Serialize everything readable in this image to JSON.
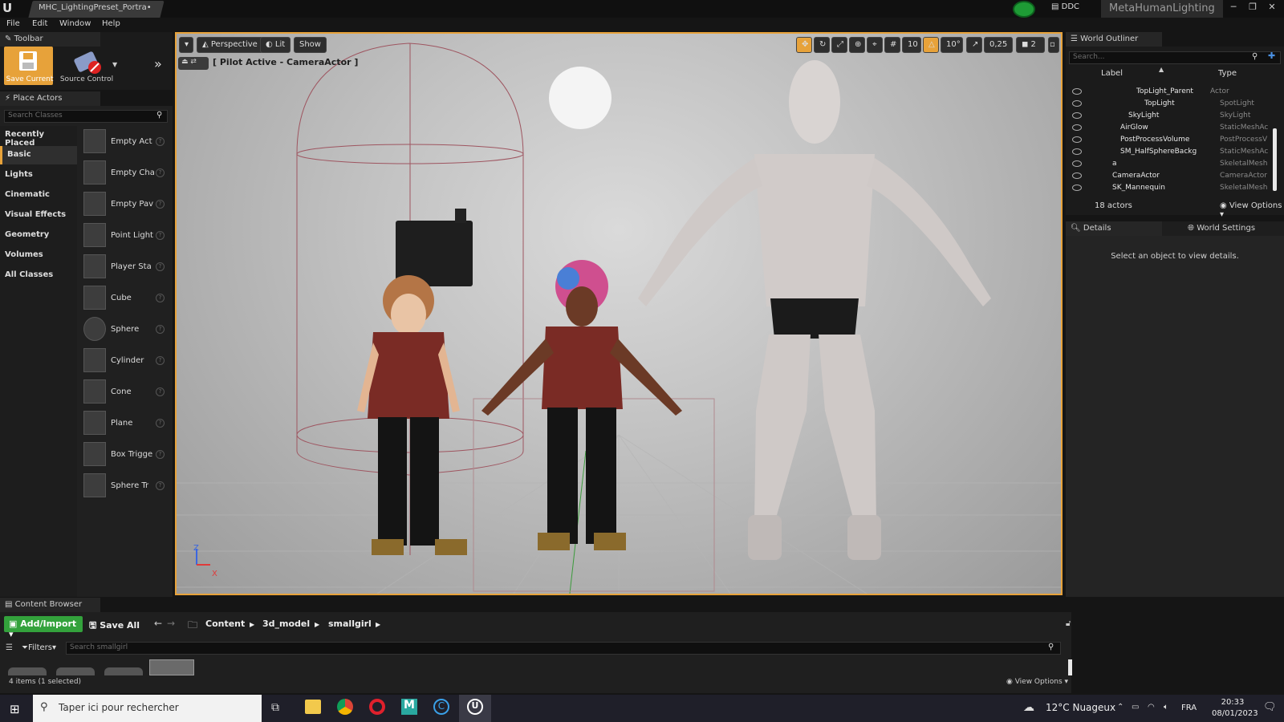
{
  "window": {
    "tab_title": "MHC_LightingPreset_Portra•",
    "ddc_label": "DDC",
    "project_name": "MetaHumanLighting"
  },
  "menu": [
    "File",
    "Edit",
    "Window",
    "Help"
  ],
  "toolbar_panel": {
    "title": "Toolbar",
    "save_label": "Save Current",
    "source_control_label": "Source Control"
  },
  "place_actors": {
    "title": "Place Actors",
    "search_placeholder": "Search Classes",
    "categories": [
      "Recently Placed",
      "Basic",
      "Lights",
      "Cinematic",
      "Visual Effects",
      "Geometry",
      "Volumes",
      "All Classes"
    ],
    "selected_category": "Basic",
    "actors": [
      "Empty Act",
      "Empty Cha",
      "Empty Pav",
      "Point Light",
      "Player Sta",
      "Cube",
      "Sphere",
      "Cylinder",
      "Cone",
      "Plane",
      "Box Trigge",
      "Sphere Tr"
    ]
  },
  "viewport": {
    "perspective_label": "Perspective",
    "lit_label": "Lit",
    "show_label": "Show",
    "pilot_label": "[ Pilot Active - CameraActor ]",
    "grid_snap": "10",
    "rotation_snap": "10°",
    "scale_snap": "0,25",
    "camera_speed": "2",
    "axis_z": "Z",
    "axis_x": "X"
  },
  "world_outliner": {
    "title": "World Outliner",
    "search_placeholder": "Search...",
    "col_label": "Label",
    "col_type": "Type",
    "rows": [
      {
        "label": "TopLight_Parent",
        "type": "Actor"
      },
      {
        "label": "TopLight",
        "type": "SpotLight"
      },
      {
        "label": "SkyLight",
        "type": "SkyLight"
      },
      {
        "label": "AirGlow",
        "type": "StaticMeshAc"
      },
      {
        "label": "PostProcessVolume",
        "type": "PostProcessV"
      },
      {
        "label": "SM_HalfSphereBackg",
        "type": "StaticMeshAc"
      },
      {
        "label": "a",
        "type": "SkeletalMesh"
      },
      {
        "label": "CameraActor",
        "type": "CameraActor"
      },
      {
        "label": "SK_Mannequin",
        "type": "SkeletalMesh"
      }
    ],
    "actors_count": "18 actors",
    "view_options": "View Options"
  },
  "details": {
    "tab_details": "Details",
    "tab_world_settings": "World Settings",
    "empty_message": "Select an object to view details."
  },
  "content_browser": {
    "title": "Content Browser",
    "add_import": "Add/Import",
    "save_all": "Save All",
    "breadcrumb": [
      "Content",
      "3d_model",
      "smallgirl"
    ],
    "filters": "Filters",
    "search_placeholder": "Search smallgirl",
    "items_count": "4 items (1 selected)",
    "view_options": "View Options"
  },
  "taskbar": {
    "search_placeholder": "Taper ici pour rechercher",
    "weather": "12°C  Nuageux",
    "language": "FRA",
    "time": "20:33",
    "date": "08/01/2023"
  },
  "colors": {
    "accent": "#e7a23a",
    "add_green": "#33a23c",
    "status_green": "#1e9b35"
  }
}
